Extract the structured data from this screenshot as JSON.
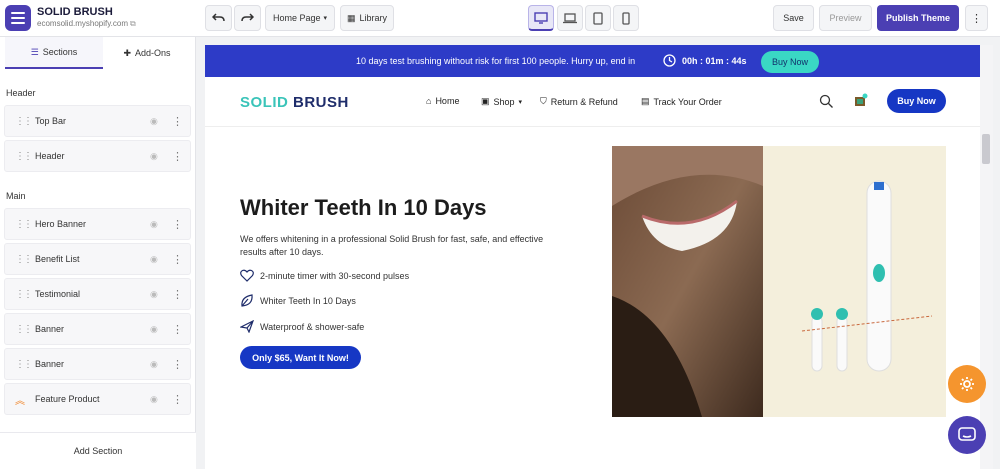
{
  "app": {
    "store_name": "SOLID BRUSH",
    "store_url": "ecomsolid.myshopify.com",
    "page_selector": "Home Page",
    "library_label": "Library",
    "save_label": "Save",
    "preview_label": "Preview",
    "publish_label": "Publish Theme",
    "accent": "#4b3fb3"
  },
  "sidebar": {
    "tabs": [
      {
        "label": "Sections",
        "icon": "list-icon"
      },
      {
        "label": "Add-Ons",
        "icon": "puzzle-icon"
      }
    ],
    "groups": [
      {
        "label": "Header",
        "items": [
          "Top Bar",
          "Header"
        ]
      },
      {
        "label": "Main",
        "items": [
          "Hero Banner",
          "Benefit List",
          "Testimonial",
          "Banner",
          "Banner",
          "Feature Product"
        ]
      }
    ],
    "add_section_label": "Add Section"
  },
  "preview": {
    "announcement": {
      "text": "10 days test brushing without risk for first 100 people. Hurry up, end in",
      "timer": "00h : 01m : 44s",
      "button": "Buy Now"
    },
    "header": {
      "brand_part1": "SOLID",
      "brand_part2": "BRUSH",
      "nav": [
        "Home",
        "Shop",
        "Return & Refund",
        "Track Your Order"
      ],
      "button": "Buy Now"
    },
    "hero": {
      "title": "Whiter Teeth In 10 Days",
      "description": "We offers whitening in a professional Solid Brush for fast, safe, and effective results after 10 days.",
      "benefits": [
        {
          "text": "2-minute timer with 30-second pulses",
          "icon": "heart-icon"
        },
        {
          "text": "Whiter Teeth In 10 Days",
          "icon": "leaf-icon"
        },
        {
          "text": "Waterproof & shower-safe",
          "icon": "plane-icon"
        }
      ],
      "cta": "Only $65, Want It Now!"
    },
    "brand_colors": {
      "primary": "#1637c4",
      "teal": "#3ad7c4",
      "announce_bg": "#2d3bc7"
    }
  }
}
